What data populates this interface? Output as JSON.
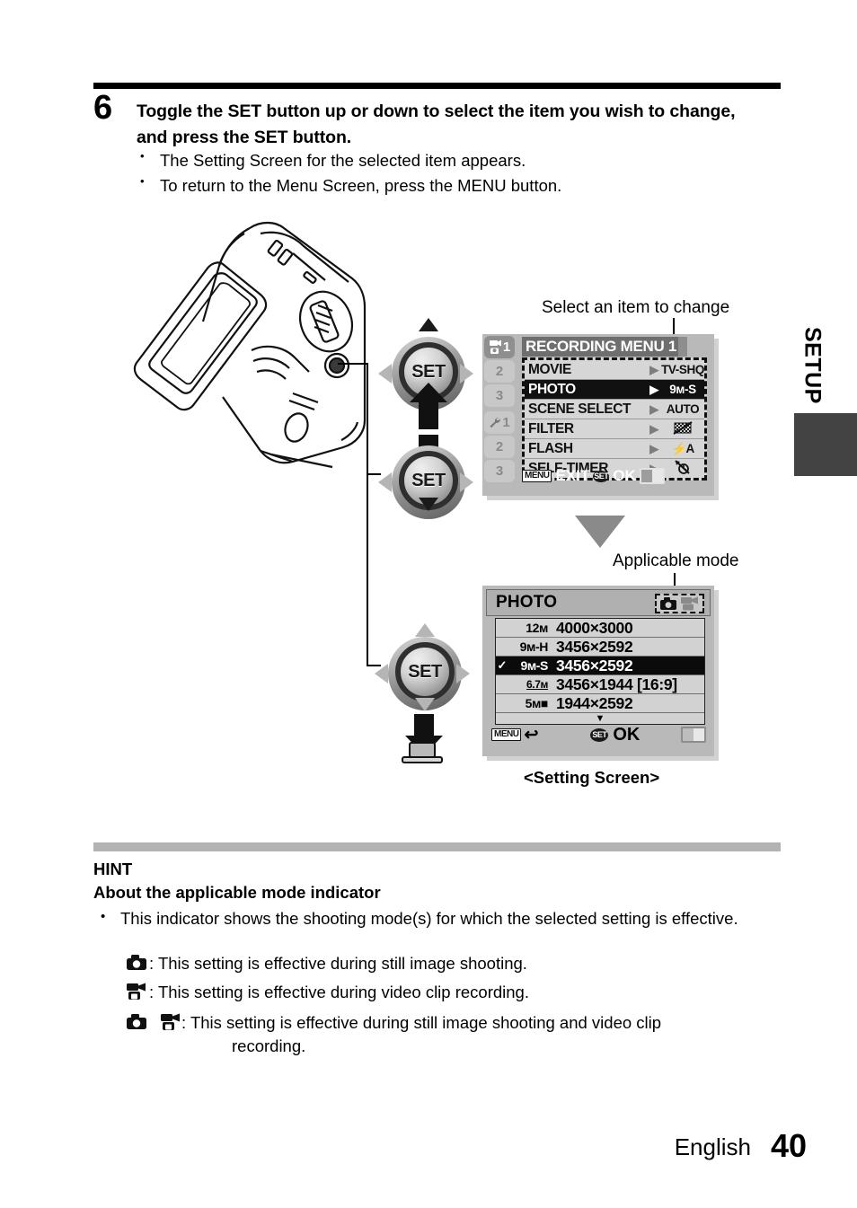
{
  "step": {
    "number": "6",
    "title": "Toggle the SET button up or down to select the item you wish to change, and press the SET button.",
    "bullets": [
      "The Setting Screen for the selected item appears.",
      "To return to the Menu Screen, press the MENU button."
    ]
  },
  "side_tab": {
    "label": "SETUP"
  },
  "callouts": {
    "select_item": "Select an item to change",
    "applicable_mode": "Applicable mode",
    "setting_screen": "<Setting Screen>"
  },
  "dials": {
    "set_label": "SET"
  },
  "recording_menu": {
    "title": "RECORDING MENU 1",
    "tabs": [
      {
        "icon": "camera-video-icon",
        "label": "1",
        "active": true
      },
      {
        "icon": "",
        "label": "2",
        "active": false
      },
      {
        "icon": "",
        "label": "3",
        "active": false
      },
      {
        "icon": "wrench-icon",
        "label": "1",
        "active": false
      },
      {
        "icon": "",
        "label": "2",
        "active": false
      },
      {
        "icon": "",
        "label": "3",
        "active": false
      }
    ],
    "rows": [
      {
        "name": "MOVIE",
        "value": "TV-SHQ",
        "value_icon": "",
        "selected": false
      },
      {
        "name": "PHOTO",
        "value": "9ᴍ-S",
        "value_icon": "",
        "selected": true
      },
      {
        "name": "SCENE SELECT",
        "value": "AUTO",
        "value_icon": "",
        "selected": false
      },
      {
        "name": "FILTER",
        "value": "",
        "value_icon": "filter-off-icon",
        "selected": false
      },
      {
        "name": "FLASH",
        "value": "⚡A",
        "value_icon": "",
        "selected": false
      },
      {
        "name": "SELF-TIMER",
        "value": "",
        "value_icon": "self-timer-off-icon",
        "selected": false
      }
    ],
    "footer": {
      "menu_key": "MENU",
      "menu_action": "EXIT",
      "set_key": "SET",
      "set_action": "OK"
    }
  },
  "photo_screen": {
    "title": "PHOTO",
    "mode_icons": [
      "still-camera-icon",
      "video-camera-icon"
    ],
    "rows": [
      {
        "check": "",
        "size": "12ᴍ",
        "dimensions": "4000×3000",
        "selected": false
      },
      {
        "check": "",
        "size": "9ᴍ-H",
        "dimensions": "3456×2592",
        "selected": false
      },
      {
        "check": "✓",
        "size": "9ᴍ-S",
        "dimensions": "3456×2592",
        "selected": true
      },
      {
        "check": "",
        "size": "6.7ᴍ",
        "dimensions": "3456×1944 [16:9]",
        "selected": false
      },
      {
        "check": "",
        "size": "5ᴍ■",
        "dimensions": "1944×2592",
        "selected": false
      }
    ],
    "scroll_more": "▼",
    "footer": {
      "menu_key": "MENU",
      "menu_action": "↩",
      "set_key": "SET",
      "set_action": "OK"
    }
  },
  "hint": {
    "heading": "HINT",
    "subheading": "About the applicable mode indicator",
    "bullet": "This indicator shows the shooting mode(s) for which the selected setting is effective.",
    "items": [
      {
        "icons": [
          "still-camera-icon"
        ],
        "text": ": This setting is effective during still image shooting."
      },
      {
        "icons": [
          "video-camera-icon"
        ],
        "text": ": This setting is effective during video clip recording."
      },
      {
        "icons": [
          "still-camera-icon",
          "video-camera-icon"
        ],
        "text": ":  This setting is effective during still image shooting and video clip",
        "text2": "recording."
      }
    ]
  },
  "footer": {
    "language": "English",
    "page": "40"
  }
}
